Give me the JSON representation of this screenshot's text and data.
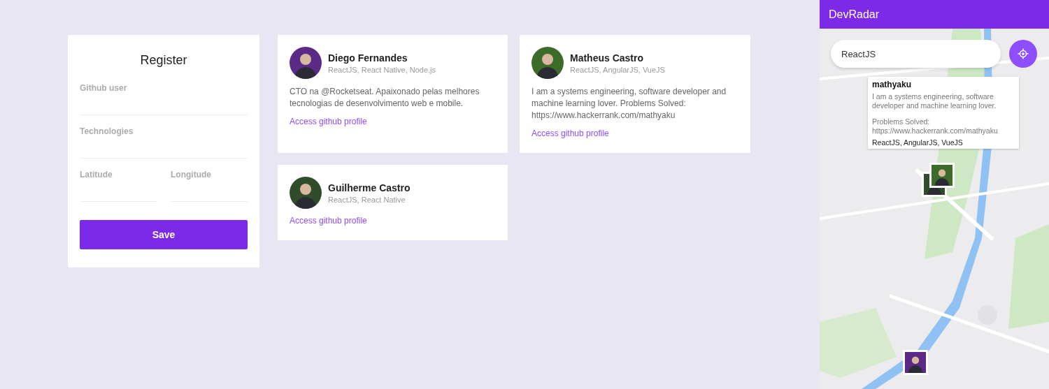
{
  "register": {
    "title": "Register",
    "fields": [
      {
        "label": "Github user"
      },
      {
        "label": "Technologies"
      },
      {
        "label": "Latitude",
        "half": true
      },
      {
        "label": "Longitude",
        "half": true
      }
    ],
    "button": "Save"
  },
  "devs": [
    {
      "name": "Diego Fernandes",
      "techs": "ReactJS, React Native, Node.js",
      "bio": "CTO na @Rocketseat. Apaixonado pelas melhores tecnologias de desenvolvimento web e mobile.",
      "link": "Access github profile"
    },
    {
      "name": "Matheus Castro",
      "techs": "ReactJS, AngularJS, VueJS",
      "bio": "I am a systems engineering, software developer and machine learning lover. Problems Solved: https://www.hackerrank.com/mathyaku",
      "link": "Access github profile"
    },
    {
      "name": "Guilherme Castro",
      "techs": "ReactJS, React Native",
      "link": "Access github profile"
    }
  ],
  "mobile": {
    "title": "DevRadar",
    "search": {
      "value": "ReactJS"
    },
    "callout": {
      "username": "mathyaku",
      "bio": [
        "I am a systems engineering, software developer and machine learning lover.",
        "Problems Solved: https://www.hackerrank.com/mathyaku"
      ],
      "techs": "ReactJS, AngularJS, VueJS"
    }
  }
}
